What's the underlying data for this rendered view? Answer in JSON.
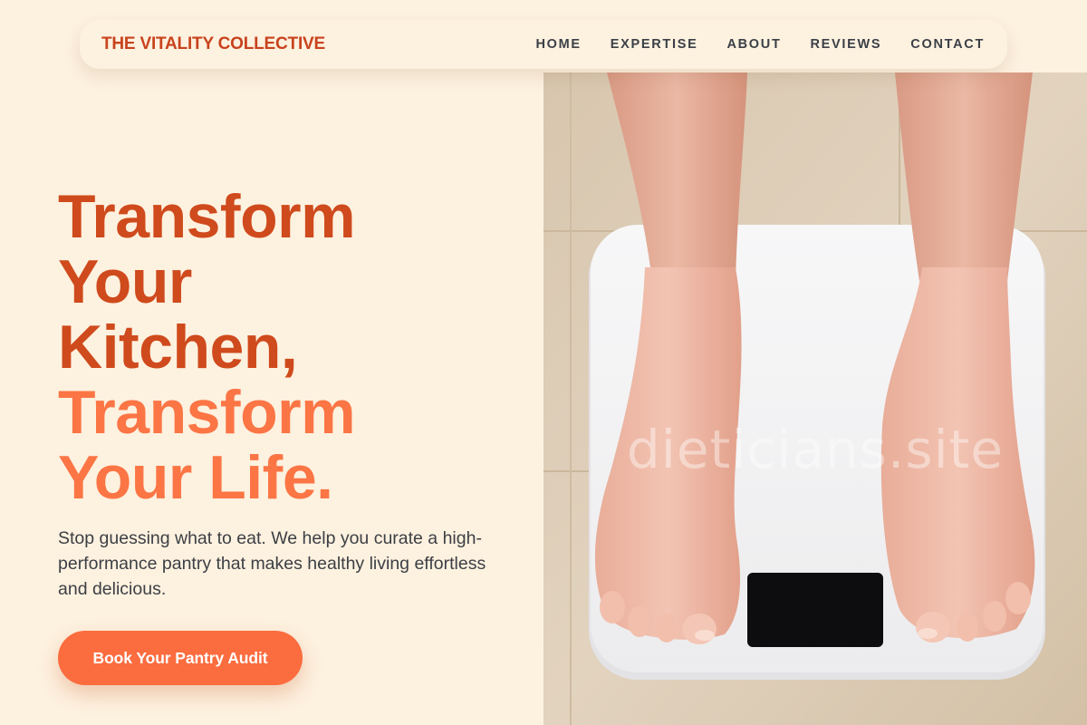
{
  "header": {
    "brand": "THE VITALITY COLLECTIVE",
    "nav": [
      {
        "label": "HOME"
      },
      {
        "label": "EXPERTISE"
      },
      {
        "label": "ABOUT"
      },
      {
        "label": "REVIEWS"
      },
      {
        "label": "CONTACT"
      }
    ]
  },
  "hero": {
    "title_lines_dark": [
      "Transform",
      "Your",
      "Kitchen,"
    ],
    "title_lines_light": [
      "Transform",
      "Your Life."
    ],
    "subtitle": "Stop guessing what to eat. We help you curate a high-performance pantry that makes healthy living effortless and delicious.",
    "cta_label": "Book Your Pantry Audit",
    "image_watermark": "dieticians.site"
  },
  "colors": {
    "background": "#fdf1df",
    "brand": "#c8431d",
    "title_dark": "#cf4a1c",
    "title_light": "#fb7545",
    "cta": "#fb6c3e",
    "nav_text": "#3b3f47"
  }
}
